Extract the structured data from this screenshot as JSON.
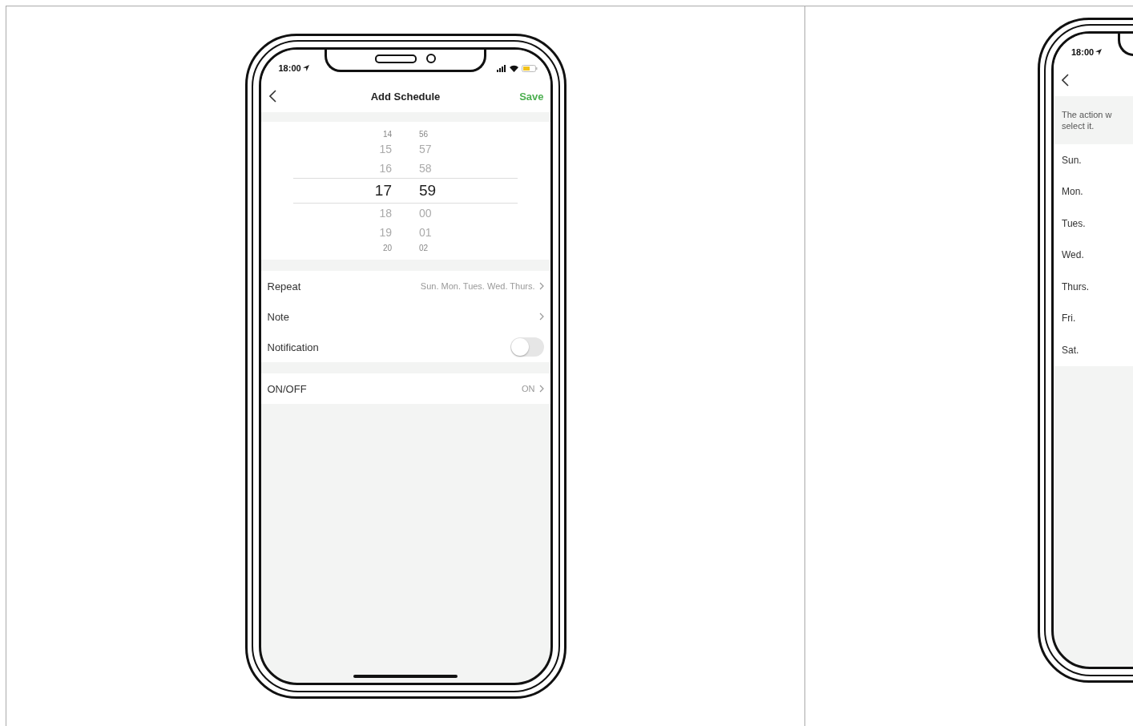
{
  "phones": [
    {
      "kind": "add_schedule",
      "status_time": "18:00",
      "title": "Add Schedule",
      "save": "Save",
      "picker": [
        {
          "hour": "14",
          "minute": "56",
          "selected": false
        },
        {
          "hour": "15",
          "minute": "57",
          "selected": false
        },
        {
          "hour": "16",
          "minute": "58",
          "selected": false
        },
        {
          "hour": "17",
          "minute": "59",
          "selected": true
        },
        {
          "hour": "18",
          "minute": "00",
          "selected": false
        },
        {
          "hour": "19",
          "minute": "01",
          "selected": false
        },
        {
          "hour": "20",
          "minute": "02",
          "selected": false
        }
      ],
      "groups": [
        [
          {
            "kind": "link",
            "label": "Repeat",
            "value": "Sun. Mon. Tues. Wed. Thurs."
          },
          {
            "kind": "link",
            "label": "Note"
          },
          {
            "kind": "toggle",
            "label": "Notification",
            "on": false
          }
        ],
        [
          {
            "kind": "link",
            "label": "ON/OFF",
            "value": "ON"
          }
        ]
      ]
    },
    {
      "kind": "repeat",
      "status_time": "18:00",
      "note_lines": [
        "The action w",
        "select it."
      ],
      "days": [
        "Sun.",
        "Mon.",
        "Tues.",
        "Wed.",
        "Thurs.",
        "Fri.",
        "Sat."
      ]
    }
  ]
}
